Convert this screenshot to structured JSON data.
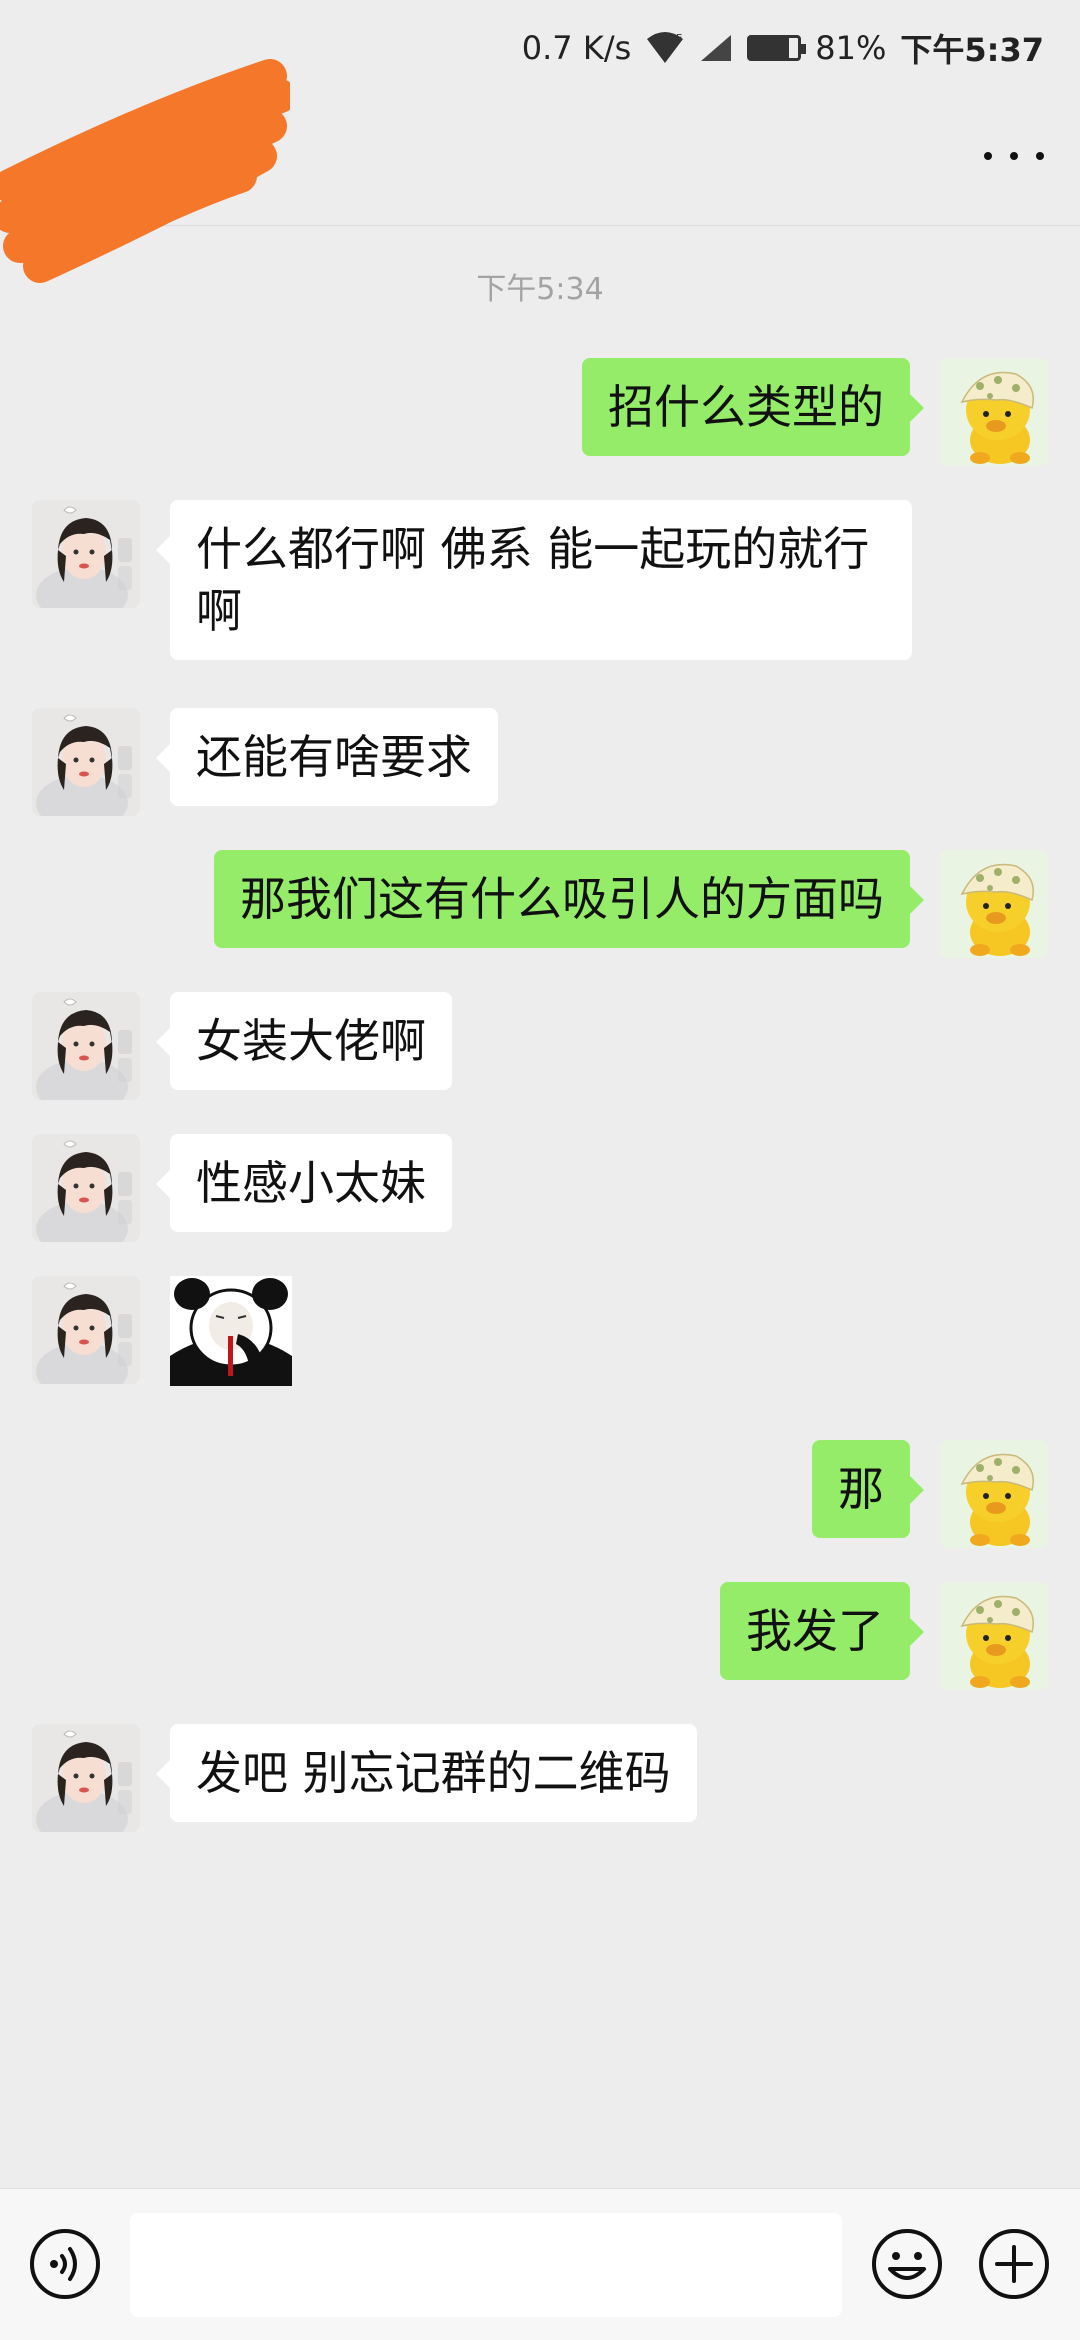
{
  "status_bar": {
    "net_speed": "0.7 K/s",
    "battery": "81%",
    "time": "下午5:37",
    "network_type": "E"
  },
  "header": {
    "contact_name": "",
    "more_icon": "more-dots-icon"
  },
  "chat": {
    "timestamp": "下午5:34",
    "messages": [
      {
        "side": "out",
        "text": "招什么类型的"
      },
      {
        "side": "in",
        "text": "什么都行啊 佛系  能一起玩的就行啊"
      },
      {
        "side": "in",
        "text": "还能有啥要求"
      },
      {
        "side": "out",
        "text": "那我们这有什么吸引人的方面吗"
      },
      {
        "side": "in",
        "text": "女装大佬啊"
      },
      {
        "side": "in",
        "text": "性感小太妹"
      },
      {
        "side": "in",
        "sticker": "panda-nosebleed-sticker"
      },
      {
        "side": "out",
        "text": "那"
      },
      {
        "side": "out",
        "text": "我发了"
      },
      {
        "side": "in",
        "text": "发吧 别忘记群的二维码"
      }
    ]
  },
  "input_bar": {
    "voice_icon": "voice-icon",
    "input_value": "",
    "emoji_icon": "emoji-icon",
    "plus_icon": "plus-icon"
  },
  "colors": {
    "background": "#ededed",
    "outgoing_bubble": "#95ec69",
    "incoming_bubble": "#ffffff",
    "redaction_scribble": "#f4772a"
  }
}
